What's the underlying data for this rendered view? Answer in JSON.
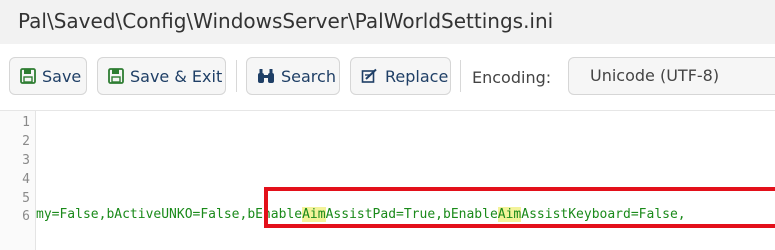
{
  "title": "Pal\\Saved\\Config\\WindowsServer\\PalWorldSettings.ini",
  "toolbar": {
    "save_label": "Save",
    "save_exit_label": "Save & Exit",
    "search_label": "Search",
    "replace_label": "Replace",
    "encoding_label": "Encoding:",
    "encoding_value": "Unicode (UTF-8)",
    "icons": [
      "floppy-disk-icon",
      "floppy-disk-icon",
      "binoculars-icon",
      "replace-icon"
    ]
  },
  "editor": {
    "line_numbers": [
      "1",
      "2",
      "3",
      "4",
      "5",
      "6"
    ],
    "line6": {
      "part1": "my=False,bActiveUNKO=False,bEnable",
      "hl1": "Aim",
      "part2": "AssistPad=True,bEnable",
      "hl2": "Aim",
      "part3": "AssistKeyboard=False,"
    },
    "highlight_color": "#f3f39a",
    "code_color": "#1a8a1a",
    "annotation_color": "#e3101a"
  }
}
